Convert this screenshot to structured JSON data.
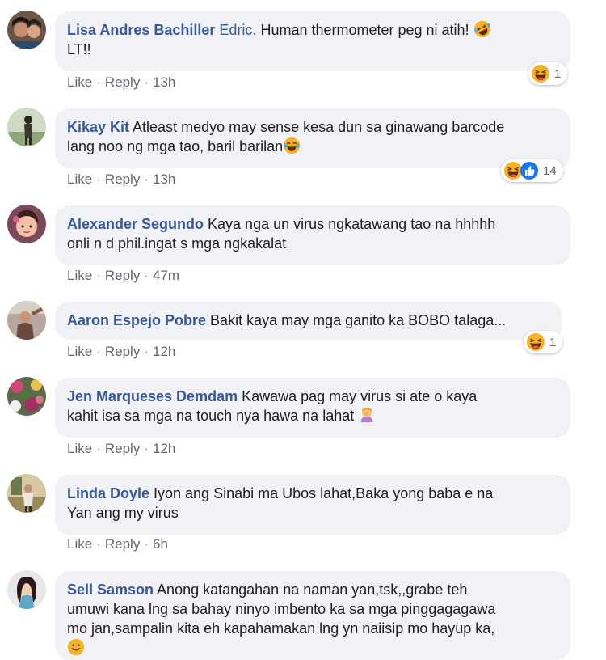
{
  "ui": {
    "like_label": "Like",
    "reply_label": "Reply",
    "separator": "·"
  },
  "comments": [
    {
      "author": "Lisa Andres Bachiller",
      "tag": "Edric.",
      "text_line1": " Human thermometer peg ni atih!",
      "text_line2": "LT!!",
      "time": "13h",
      "reaction_count": "1",
      "reactions": [
        "haha"
      ]
    },
    {
      "author": "Kikay Kit",
      "text_line1": " Atleast medyo may sense kesa dun sa ginawang barcode",
      "text_line2": "lang noo ng mga tao, baril barilan",
      "time": "13h",
      "reaction_count": "14",
      "reactions": [
        "haha",
        "like"
      ]
    },
    {
      "author": "Alexander Segundo",
      "text_line1": " Kaya nga un virus ngkatawang tao na hhhhh",
      "text_line2": "onli n d phil.ingat s mga ngkakalat",
      "time": "47m"
    },
    {
      "author": "Aaron Espejo Pobre",
      "text_line1": " Bakit kaya may mga ganito ka BOBO talaga...",
      "time": "12h",
      "reaction_count": "1",
      "reactions": [
        "haha"
      ]
    },
    {
      "author": "Jen Marqueses Demdam",
      "text_line1": " Kawawa pag may virus si ate o kaya",
      "text_line2": "kahit isa sa mga na touch nya hawa na lahat",
      "time": "12h"
    },
    {
      "author": "Linda Doyle",
      "text_line1": " Iyon ang Sinabi ma Ubos lahat,Baka yong baba e na",
      "text_line2": "Yan ang my virus",
      "time": "6h"
    },
    {
      "author": "Sell Samson",
      "text_line1": " Anong katangahan na naman yan,tsk,,grabe teh",
      "text_line2": "umuwi kana lng sa bahay ninyo imbento ka sa mga pinggagagawa",
      "text_line3": "mo jan,sampalin kita eh kapahamakan lng yn naiisip mo hayup ka,"
    }
  ],
  "colors": {
    "author_link": "#385898",
    "bubble_bg": "#f0f2f5",
    "meta_text": "#616770",
    "like_blue": "#1877f2",
    "haha_yellow": "#f7b125"
  },
  "icons": {
    "haha": "laughing-face-icon",
    "like": "thumbs-up-icon",
    "rofl": "rolling-laughing-emoji",
    "joy": "tears-of-joy-emoji",
    "facepalm": "woman-facepalming-emoji",
    "grin": "grinning-emoji"
  }
}
